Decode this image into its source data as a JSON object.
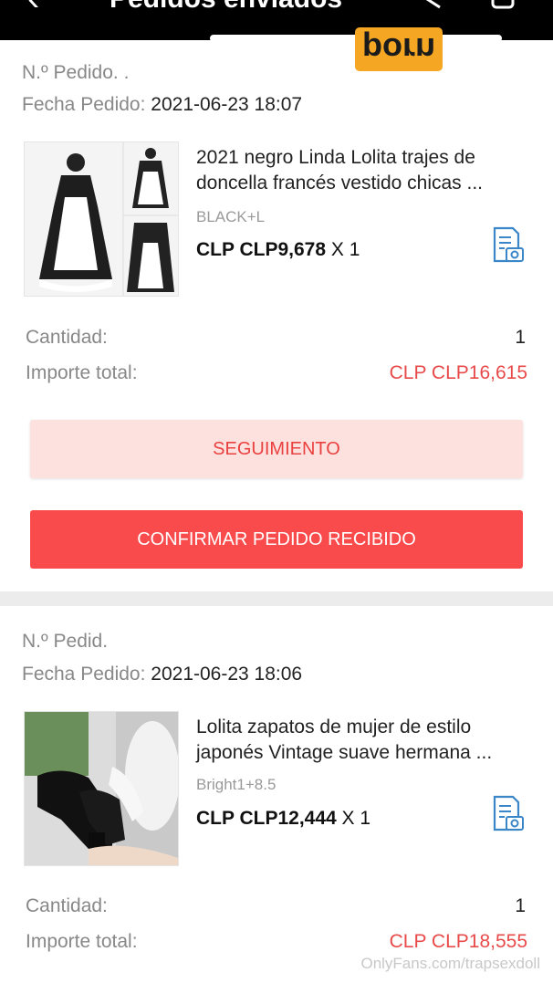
{
  "header": {
    "title": "Pedidos enviados",
    "back_icon": "back-arrow-icon"
  },
  "badge": {
    "text": "porn",
    "color": "#f5a623"
  },
  "orders": [
    {
      "order_label": "N.º Pedido. .",
      "date_label": "Fecha Pedido:",
      "date_value": "2021-06-23 18:07",
      "product_title": "2021 negro Linda Lolita trajes de doncella francés vestido chicas ...",
      "variant": "BLACK+L",
      "price": "CLP CLP9,678",
      "qty": "X 1",
      "cantidad_label": "Cantidad:",
      "cantidad_value": "1",
      "total_label": "Importe total:",
      "total_value": "CLP CLP16,615"
    },
    {
      "order_label": "N.º Pedid.",
      "date_label": "Fecha Pedido:",
      "date_value": "2021-06-23 18:06",
      "product_title": "Lolita zapatos de mujer de estilo japonés Vintage suave hermana ...",
      "variant": "Bright1+8.5",
      "price": "CLP CLP12,444",
      "qty": "X 1",
      "cantidad_label": "Cantidad:",
      "cantidad_value": "1",
      "total_label": "Importe total:",
      "total_value": "CLP CLP18,555"
    }
  ],
  "buttons": {
    "tracking": "SEGUIMIENTO",
    "confirm": "CONFIRMAR PEDIDO RECIBIDO"
  },
  "watermark": "OnlyFans.com/trapsexdoll",
  "colors": {
    "accent": "#f94b4b",
    "price_red": "#e84a4a",
    "icon_blue": "#3a86c8"
  }
}
